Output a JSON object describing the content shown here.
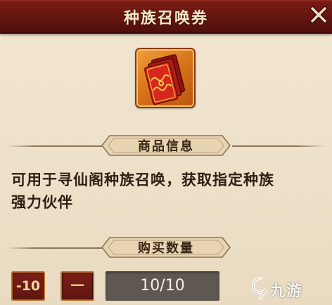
{
  "header": {
    "title": "种族召唤券",
    "close_icon": "close-icon"
  },
  "item": {
    "icon": "red-envelope-ticket-icon"
  },
  "sections": {
    "info_heading": "商品信息",
    "description_line1": "可用于寻仙阁种族召唤，获取指定种族",
    "description_line2": "强力伙伴",
    "quantity_heading": "购买数量"
  },
  "quantity": {
    "minus10_label": "-10",
    "minus1_label": "一",
    "value": "10/10"
  },
  "watermark": {
    "text": "九游",
    "icon": "jiuyou-logo-icon"
  },
  "colors": {
    "header_bg": "#641511",
    "header_text": "#f5e9c8",
    "panel_bg": "#efe4cf",
    "button_bg": "#6a1912",
    "field_bg": "#5f5852"
  }
}
